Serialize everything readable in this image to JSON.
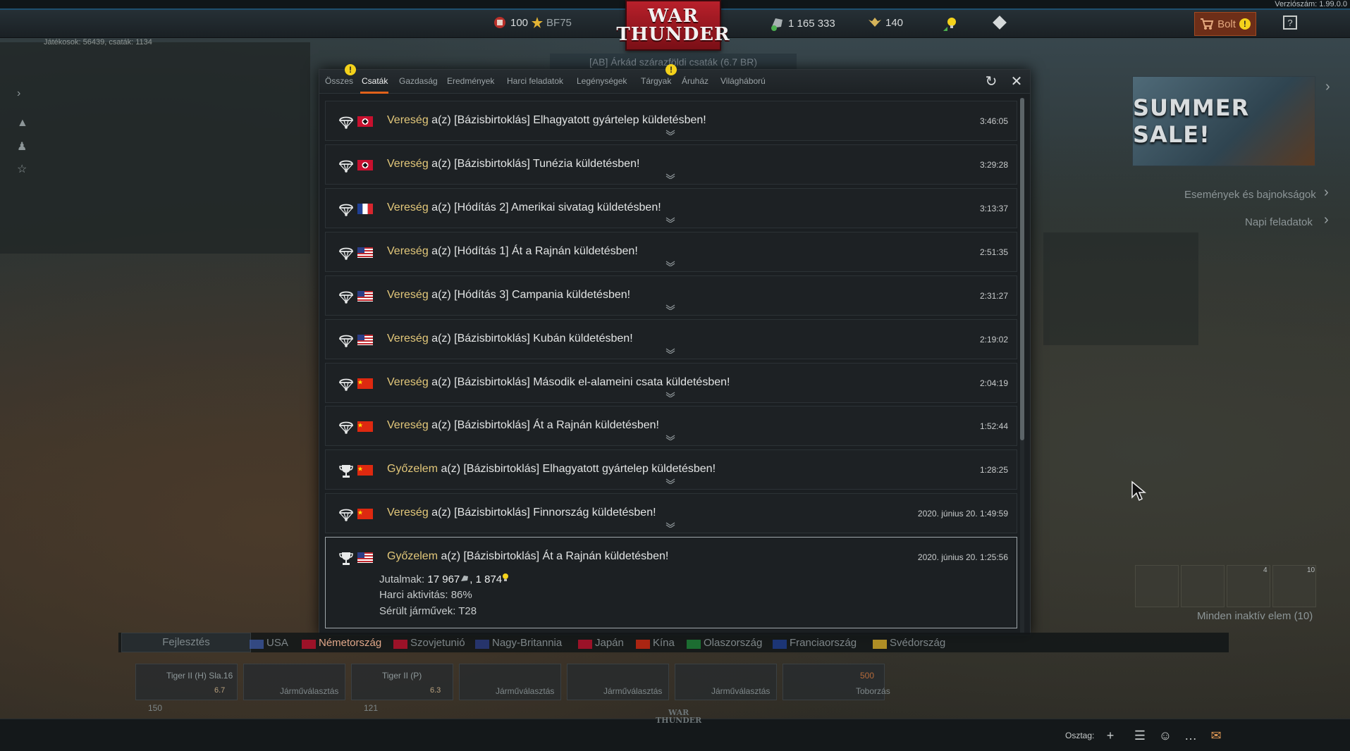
{
  "version": "Verziószám: 1.99.0.0",
  "players_info": "Játékosok: 56439, csaták: 1134",
  "topbar": {
    "level": "100",
    "rank": "BF75",
    "silver_lions": "1 165 333",
    "golden_eagles": "140",
    "shop_label": "Bolt"
  },
  "logo": {
    "line1": "WAR",
    "line2": "THUNDER"
  },
  "behind_title": "[AB] Árkád szárazföldi csaták (6.7 BR)",
  "tabs": [
    {
      "label": "Összes"
    },
    {
      "label": "Csaták"
    },
    {
      "label": "Gazdaság"
    },
    {
      "label": "Eredmények"
    },
    {
      "label": "Harci feladatok"
    },
    {
      "label": "Legénységek"
    },
    {
      "label": "Tárgyak"
    },
    {
      "label": "Áruház"
    },
    {
      "label": "Világháború"
    }
  ],
  "messages": [
    {
      "result": "Vereség",
      "text": " a(z) [Bázisbirtoklás] Elhagyatott gyártelep küldetésben!",
      "time": "3:46:05",
      "flag": "de",
      "won": false
    },
    {
      "result": "Vereség",
      "text": " a(z) [Bázisbirtoklás] Tunézia küldetésben!",
      "time": "3:29:28",
      "flag": "de",
      "won": false
    },
    {
      "result": "Vereség",
      "text": " a(z) [Hódítás 2] Amerikai sivatag küldetésben!",
      "time": "3:13:37",
      "flag": "fr",
      "won": false
    },
    {
      "result": "Vereség",
      "text": " a(z) [Hódítás 1] Át a Rajnán küldetésben!",
      "time": "2:51:35",
      "flag": "us",
      "won": false
    },
    {
      "result": "Vereség",
      "text": " a(z) [Hódítás 3] Campania küldetésben!",
      "time": "2:31:27",
      "flag": "us",
      "won": false
    },
    {
      "result": "Vereség",
      "text": " a(z) [Bázisbirtoklás] Kubán küldetésben!",
      "time": "2:19:02",
      "flag": "us",
      "won": false
    },
    {
      "result": "Vereség",
      "text": " a(z) [Bázisbirtoklás] Második el-alameini csata küldetésben!",
      "time": "2:04:19",
      "flag": "cn",
      "won": false
    },
    {
      "result": "Vereség",
      "text": " a(z) [Bázisbirtoklás] Át a Rajnán küldetésben!",
      "time": "1:52:44",
      "flag": "cn",
      "won": false
    },
    {
      "result": "Győzelem",
      "text": " a(z) [Bázisbirtoklás] Elhagyatott gyártelep küldetésben!",
      "time": "1:28:25",
      "flag": "cn",
      "won": true
    },
    {
      "result": "Vereség",
      "text": " a(z) [Bázisbirtoklás] Finnország küldetésben!",
      "time": "2020. június 20. 1:49:59",
      "flag": "cn",
      "won": false
    }
  ],
  "expanded": {
    "result": "Győzelem",
    "text": " a(z) [Bázisbirtoklás] Át a Rajnán küldetésben!",
    "time": "2020. június 20. 1:25:56",
    "flag": "us",
    "rewards_label": "Jutalmak:",
    "rewards_value": "17 967",
    "rewards_rp": ", 1 874",
    "activity": "Harci aktivitás: 86%",
    "damaged": "Sérült járművek: T28"
  },
  "side": {
    "promo": "SUMMER SALE!",
    "events": "Események és bajnokságok",
    "daily": "Napi feladatok",
    "slot_counts": [
      "4",
      "10"
    ],
    "inactive": "Minden inaktív elem (10)"
  },
  "bottom": {
    "dev": "Fejlesztés",
    "countries": [
      "USA",
      "Németország",
      "Szovjetunió",
      "Nagy-Britannia",
      "Japán",
      "Kína",
      "Olaszország",
      "Franciaország",
      "Svédország"
    ],
    "cards": [
      {
        "name": "Tiger II (H) Sla.16",
        "br": "6.7",
        "cost": "150",
        "label": ""
      },
      {
        "name": "",
        "br": "",
        "cost": "",
        "label": "Járműválasztás"
      },
      {
        "name": "Tiger II (P)",
        "br": "6.3",
        "cost": "121",
        "label": ""
      },
      {
        "name": "",
        "br": "",
        "cost": "",
        "label": "Járműválasztás"
      },
      {
        "name": "",
        "br": "",
        "cost": "",
        "label": "Járműválasztás"
      },
      {
        "name": "",
        "br": "",
        "cost": "",
        "label": "Járműválasztás"
      },
      {
        "name": "500",
        "br": "",
        "cost": "",
        "label": "Toborzás"
      }
    ],
    "squad_label": "Osztag:",
    "logo_line1": "WAR",
    "logo_line2": "THUNDER"
  },
  "colors": {
    "accent": "#e1621b",
    "result": "#e3c87a",
    "warning": "#f4d21b"
  }
}
